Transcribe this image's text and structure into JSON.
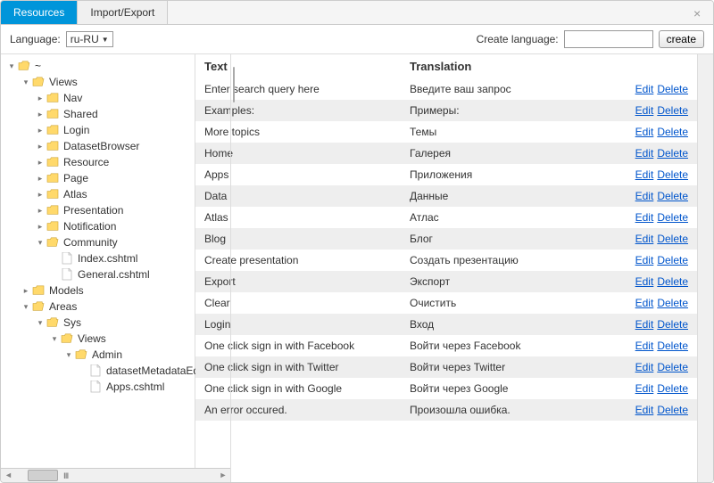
{
  "tabs": {
    "resources": "Resources",
    "import_export": "Import/Export"
  },
  "topbar": {
    "language_label": "Language:",
    "language_value": "ru-RU",
    "create_lang_label": "Create language:",
    "create_btn": "create"
  },
  "tree": {
    "root": "~",
    "views": "Views",
    "nav": "Nav",
    "shared": "Shared",
    "login": "Login",
    "dataset_browser": "DatasetBrowser",
    "resource": "Resource",
    "page": "Page",
    "atlas": "Atlas",
    "presentation": "Presentation",
    "notification": "Notification",
    "community": "Community",
    "index_cshtml": "Index.cshtml",
    "general_cshtml": "General.cshtml",
    "models": "Models",
    "areas": "Areas",
    "sys": "Sys",
    "sys_views": "Views",
    "admin": "Admin",
    "dataset_meta": "datasetMetadataEditor.cs",
    "apps_cshtml": "Apps.cshtml"
  },
  "table": {
    "header_text": "Text",
    "header_translation": "Translation",
    "edit": "Edit",
    "delete": "Delete",
    "rows": [
      {
        "text": "Enter search query here",
        "translation": "Введите ваш запрос"
      },
      {
        "text": "Examples:",
        "translation": "Примеры:"
      },
      {
        "text": "More topics",
        "translation": "Темы"
      },
      {
        "text": "Home",
        "translation": "Галерея"
      },
      {
        "text": "Apps",
        "translation": "Приложения"
      },
      {
        "text": "Data",
        "translation": "Данные"
      },
      {
        "text": "Atlas",
        "translation": "Атлас"
      },
      {
        "text": "Blog",
        "translation": "Блог"
      },
      {
        "text": "Create presentation",
        "translation": "Создать презентацию"
      },
      {
        "text": "Export",
        "translation": "Экспорт"
      },
      {
        "text": "Clear",
        "translation": "Очистить"
      },
      {
        "text": "Login",
        "translation": "Вход"
      },
      {
        "text": "One click sign in with Facebook",
        "translation": "Войти через Facebook"
      },
      {
        "text": "One click sign in with Twitter",
        "translation": "Войти через Twitter"
      },
      {
        "text": "One click sign in with Google",
        "translation": "Войти через Google"
      },
      {
        "text": "An error occured.",
        "translation": "Произошла ошибка."
      }
    ]
  }
}
